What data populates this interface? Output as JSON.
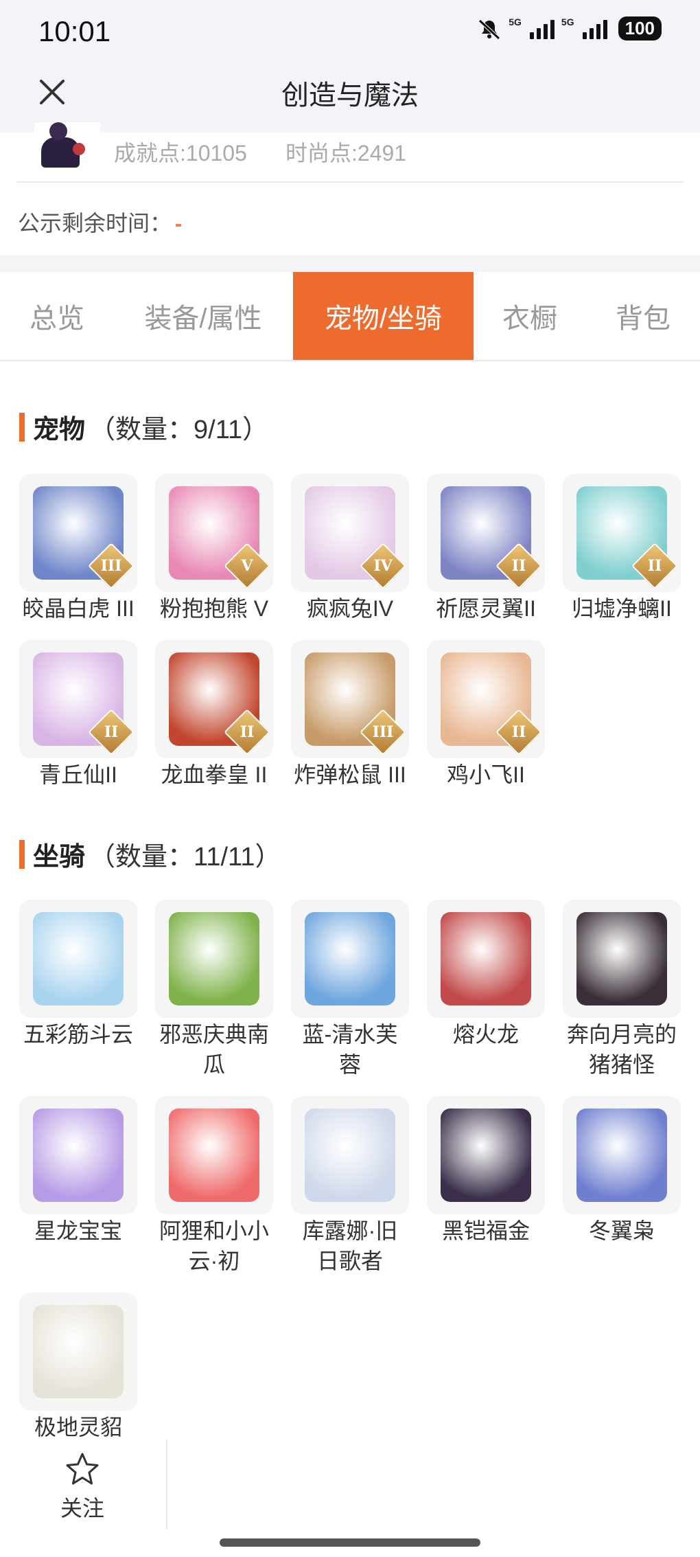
{
  "status_bar": {
    "time": "10:01",
    "network": "5G",
    "battery": "100"
  },
  "header": {
    "title": "创造与魔法",
    "close_icon": "close-icon"
  },
  "profile": {
    "achievement": "成就点:10105",
    "fashion": "时尚点:2491"
  },
  "notice": {
    "label": "公示剩余时间："
  },
  "tabs": [
    {
      "label": "总览",
      "active": false
    },
    {
      "label": "装备/属性",
      "active": false
    },
    {
      "label": "宠物/坐骑",
      "active": true
    },
    {
      "label": "衣橱",
      "active": false
    },
    {
      "label": "背包",
      "active": false
    }
  ],
  "colors": {
    "accent": "#ee6b2d"
  },
  "pets": {
    "title": "宠物",
    "count": "（数量：9/11）",
    "items": [
      {
        "name": "皎晶白虎 III",
        "badge": "III",
        "icon": "white-tiger-icon",
        "color": "#6f86c9"
      },
      {
        "name": "粉抱抱熊 V",
        "badge": "V",
        "icon": "pink-bear-icon",
        "color": "#e889b4"
      },
      {
        "name": "疯疯兔IV",
        "badge": "IV",
        "icon": "crazy-rabbit-icon",
        "color": "#e3c9e6"
      },
      {
        "name": "祈愿灵翼II",
        "badge": "II",
        "icon": "wish-wing-bird-icon",
        "color": "#7d84c4"
      },
      {
        "name": "归墟净螭II",
        "badge": "II",
        "icon": "jade-dragon-icon",
        "color": "#7fcfcf"
      },
      {
        "name": "青丘仙II",
        "badge": "II",
        "icon": "fox-fairy-icon",
        "color": "#d9b5e6"
      },
      {
        "name": "龙血拳皇 II",
        "badge": "II",
        "icon": "dragon-blood-fighter-icon",
        "color": "#c2462e"
      },
      {
        "name": "炸弹松鼠 III",
        "badge": "III",
        "icon": "bomb-squirrel-icon",
        "color": "#c79a68"
      },
      {
        "name": "鸡小飞II",
        "badge": "II",
        "icon": "chicken-flyer-icon",
        "color": "#e8b793"
      }
    ]
  },
  "mounts": {
    "title": "坐骑",
    "count": "（数量：11/11）",
    "items": [
      {
        "name": "五彩筋斗云",
        "icon": "cloud-icon",
        "color": "#a9d4ef"
      },
      {
        "name": "邪恶庆典南瓜",
        "icon": "evil-pumpkin-icon",
        "color": "#7fb24a"
      },
      {
        "name": "蓝-清水芙蓉",
        "icon": "blue-lotus-icon",
        "color": "#6ea6de"
      },
      {
        "name": "熔火龙",
        "icon": "lava-dragon-icon",
        "color": "#c24a4a"
      },
      {
        "name": "奔向月亮的猪猪怪",
        "icon": "moon-pig-icon",
        "color": "#3a2e38"
      },
      {
        "name": "星龙宝宝",
        "icon": "star-dragon-baby-icon",
        "color": "#b79be6"
      },
      {
        "name": "阿狸和小小云·初",
        "icon": "ali-fox-cloud-icon",
        "color": "#ef6a6a"
      },
      {
        "name": "库露娜·旧日歌者",
        "icon": "kuluna-singer-icon",
        "color": "#cfd8ea"
      },
      {
        "name": "黑铠福金",
        "icon": "black-armor-dragon-icon",
        "color": "#3b2f4a"
      },
      {
        "name": "冬翼枭",
        "icon": "winter-owl-icon",
        "color": "#6f7fcf"
      },
      {
        "name": "极地灵貂",
        "icon": "polar-marten-icon",
        "color": "#e7e2d8"
      }
    ]
  },
  "bottom": {
    "follow_label": "关注"
  }
}
